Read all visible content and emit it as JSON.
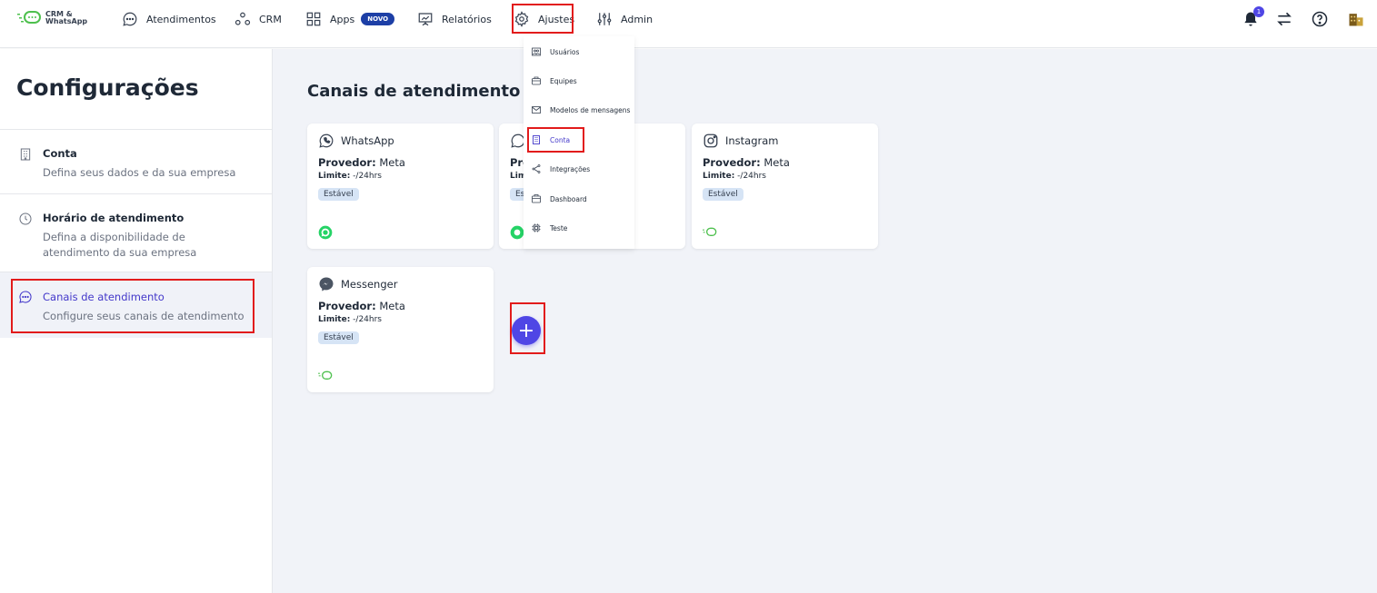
{
  "logo": {
    "line1": "CRM &",
    "line2": "WhatsApp",
    "icon": "chat-bubbles-logo-icon"
  },
  "nav": {
    "atendimentos": "Atendimentos",
    "crm": "CRM",
    "apps": "Apps",
    "apps_badge": "NOVO",
    "relatorios": "Relatórios",
    "ajustes": "Ajustes",
    "admin": "Admin"
  },
  "topright": {
    "notifications_count": "1"
  },
  "dropdown": {
    "items": [
      {
        "label": "Usuários",
        "icon": "users-icon"
      },
      {
        "label": "Equipes",
        "icon": "briefcase-icon"
      },
      {
        "label": "Modelos de mensagens",
        "icon": "mail-icon"
      },
      {
        "label": "Conta",
        "icon": "building-icon"
      },
      {
        "label": "Integrações",
        "icon": "share-icon"
      },
      {
        "label": "Dashboard",
        "icon": "dashboard-icon"
      },
      {
        "label": "Teste",
        "icon": "cpu-icon"
      }
    ]
  },
  "sidebar": {
    "title": "Configurações",
    "items": [
      {
        "title": "Conta",
        "desc": "Defina seus dados e da sua empresa",
        "icon": "building-icon"
      },
      {
        "title": "Horário de atendimento",
        "desc": "Defina a disponibilidade de atendimento da sua empresa",
        "icon": "clock-icon"
      },
      {
        "title": "Canais de atendimento",
        "desc": "Configure seus canais de atendimento",
        "icon": "chat-icon"
      }
    ]
  },
  "main": {
    "title": "Canais de atendimento",
    "cards": [
      {
        "name": "WhatsApp",
        "provider_label": "Provedor:",
        "provider": "Meta",
        "limit_label": "Limite:",
        "limit": "-/24hrs",
        "tag": "Estável"
      },
      {
        "name": "",
        "provider_label": "Pro",
        "provider": "",
        "limit_label": "Lim",
        "limit": "",
        "tag": "Es"
      },
      {
        "name": "Instagram",
        "provider_label": "Provedor:",
        "provider": "Meta",
        "limit_label": "Limite:",
        "limit": "-/24hrs",
        "tag": "Estável"
      },
      {
        "name": "Messenger",
        "provider_label": "Provedor:",
        "provider": "Meta",
        "limit_label": "Limite:",
        "limit": "-/24hrs",
        "tag": "Estável"
      }
    ],
    "add_button": "+"
  },
  "colors": {
    "accent": "#4f46e5",
    "highlight": "#e21b1b",
    "badge": "#1d3fa6",
    "whatsapp": "#25d366"
  }
}
